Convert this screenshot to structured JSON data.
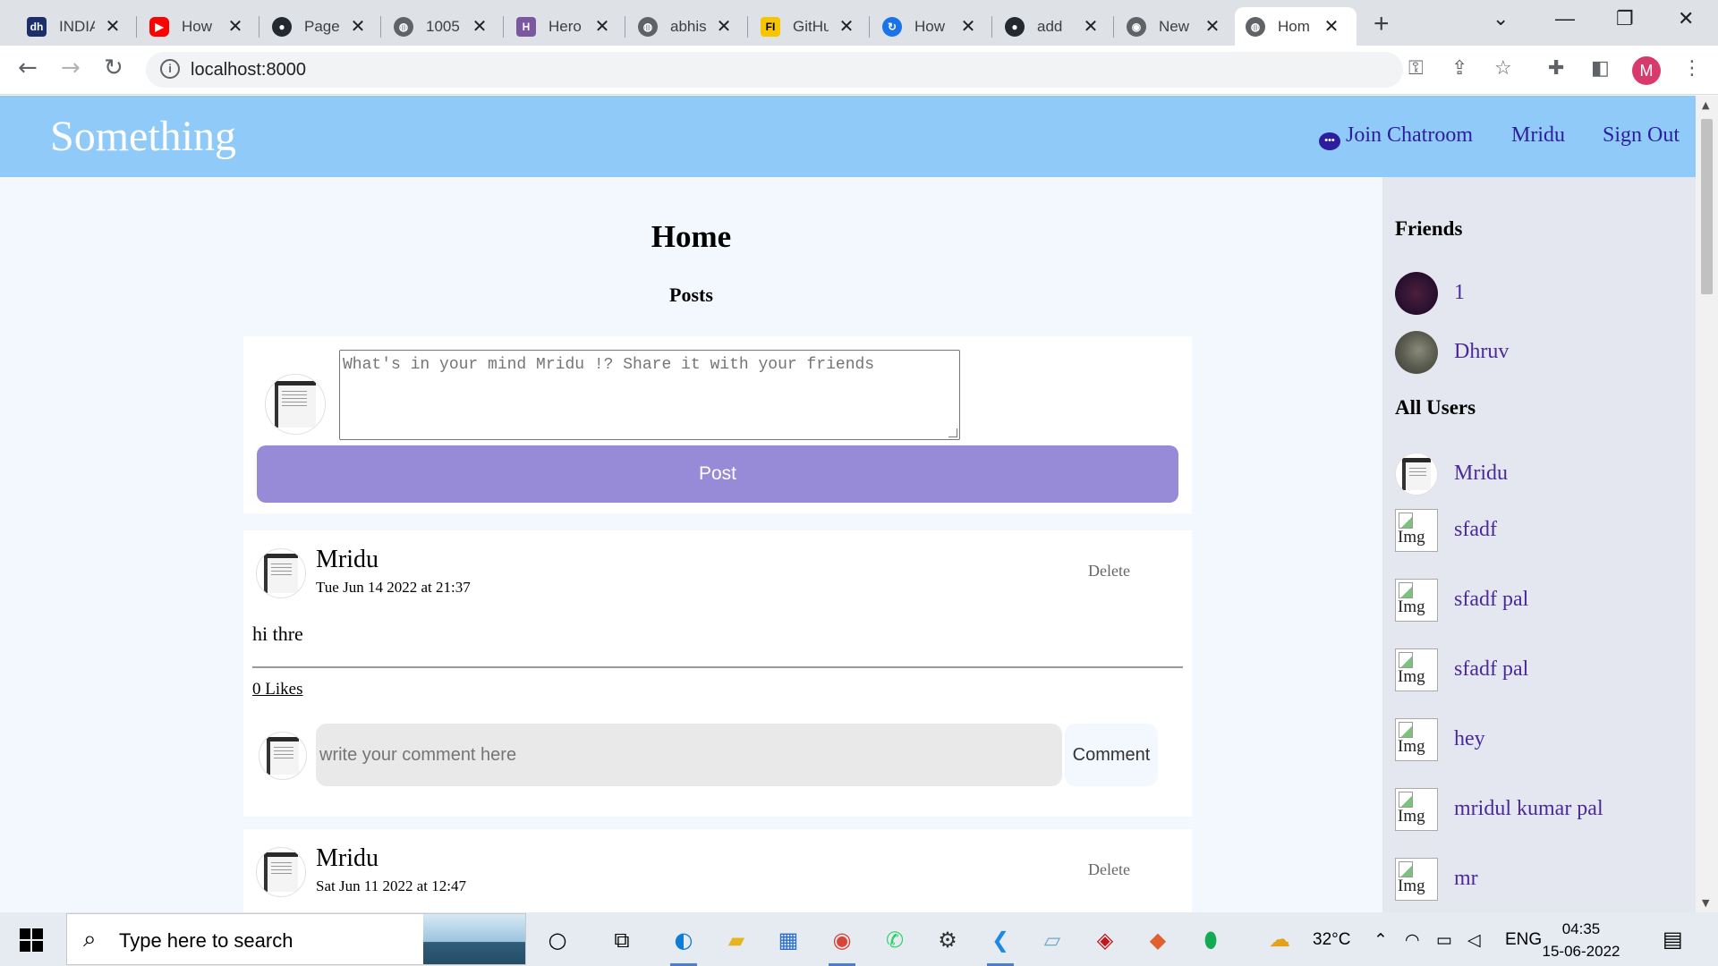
{
  "browser": {
    "tabs": [
      {
        "title": "INDIA",
        "icon": "dh-logo-icon",
        "color": "#1c2f6b"
      },
      {
        "title": "How",
        "icon": "youtube-icon",
        "color": "#ff0000"
      },
      {
        "title": "Page",
        "icon": "github-icon",
        "color": "#24292f"
      },
      {
        "title": "1005",
        "icon": "globe-icon",
        "color": "#5f6368"
      },
      {
        "title": "Hero",
        "icon": "heroku-icon",
        "color": "#79589f"
      },
      {
        "title": "abhis",
        "icon": "globe-icon",
        "color": "#5f6368"
      },
      {
        "title": "GitHu",
        "icon": "fi-logo-icon",
        "color": "#f7c600"
      },
      {
        "title": "How",
        "icon": "loading-icon",
        "color": "#1a73e8"
      },
      {
        "title": "add",
        "icon": "github-icon",
        "color": "#24292f"
      },
      {
        "title": "New",
        "icon": "chrome-icon",
        "color": "#5f6368"
      },
      {
        "title": "Hom",
        "icon": "globe-icon",
        "color": "#5f6368",
        "active": true
      }
    ],
    "url": "localhost:8000",
    "profile_initial": "M"
  },
  "site": {
    "brand": "Something",
    "nav": {
      "chatroom": "Join Chatroom",
      "user": "Mridu",
      "signout": "Sign Out"
    }
  },
  "main": {
    "title": "Home",
    "posts_heading": "Posts",
    "composer": {
      "placeholder": "What's in your mind Mridu !? Share it with your friends",
      "button": "Post"
    },
    "posts": [
      {
        "author": "Mridu",
        "date": "Tue Jun 14 2022 at 21:37",
        "delete": "Delete",
        "text": "hi thre",
        "likes": "0 Likes",
        "comment_placeholder": "write your comment here",
        "comment_button": "Comment"
      },
      {
        "author": "Mridu",
        "date": "Sat Jun 11 2022 at 12:47",
        "delete": "Delete"
      }
    ]
  },
  "sidebar": {
    "friends_heading": "Friends",
    "friends": [
      {
        "name": "1"
      },
      {
        "name": "Dhruv"
      }
    ],
    "users_heading": "All Users",
    "users": [
      {
        "name": "Mridu",
        "image": "avatar"
      },
      {
        "name": "sfadf",
        "image_alt": "Img"
      },
      {
        "name": "sfadf pal",
        "image_alt": "Img"
      },
      {
        "name": "sfadf pal",
        "image_alt": "Img"
      },
      {
        "name": "hey",
        "image_alt": "Img"
      },
      {
        "name": "mridul kumar pal",
        "image_alt": "Img"
      },
      {
        "name": "mr",
        "image_alt": "Img"
      }
    ]
  },
  "taskbar": {
    "search_placeholder": "Type here to search",
    "weather": "32°C",
    "language": "ENG",
    "time": "04:35",
    "date": "15-06-2022"
  },
  "colors": {
    "navbar": "#90caf9",
    "post_button": "#978bd8",
    "link": "#4a2a9a",
    "nav_link": "#2d1e9e"
  }
}
